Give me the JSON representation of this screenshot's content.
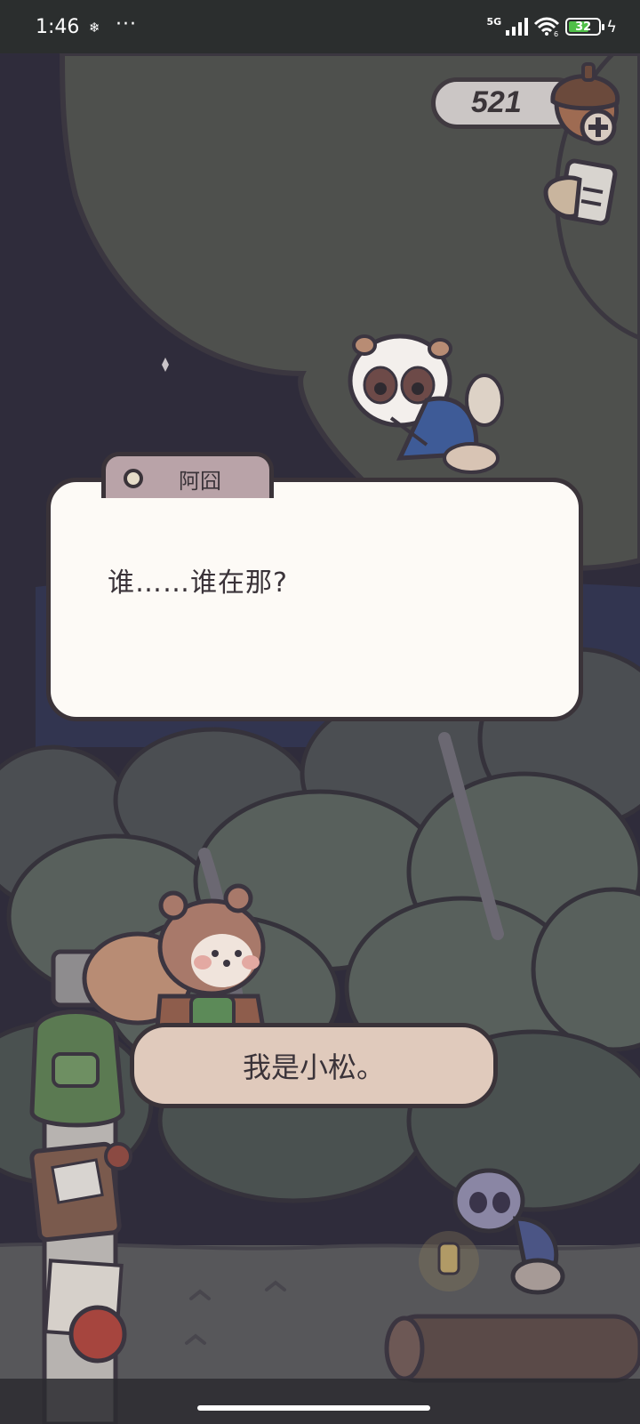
{
  "status_bar": {
    "time": "1:46",
    "more": "···",
    "network": "5G",
    "wifi_label": "6",
    "battery": "32"
  },
  "hud": {
    "acorn_count": "521"
  },
  "dialog": {
    "speaker": "阿囧",
    "text": "谁……谁在那?"
  },
  "choices": [
    {
      "label": "我是小松。"
    }
  ],
  "colors": {
    "sky": "#2f2c3b",
    "tree_canopy": "#4e504d",
    "dialog_bg": "#fdfaf6",
    "speaker_tab": "#b9a3a8",
    "choice_bg": "#e0cabc",
    "outline": "#3a3339"
  },
  "icons": [
    "acorn-icon",
    "plus-icon",
    "task-card-icon",
    "signal-icon",
    "wifi-icon",
    "battery-icon",
    "charging-icon"
  ]
}
